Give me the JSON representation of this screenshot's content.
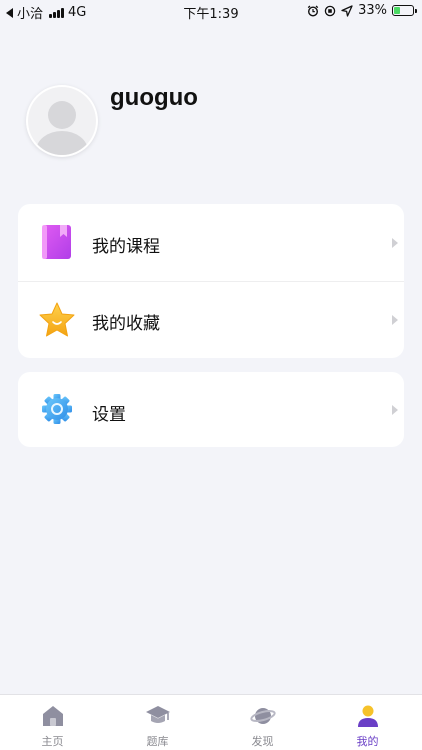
{
  "status_bar": {
    "carrier": "小洽",
    "network": "4G",
    "time": "下午1:39",
    "battery": "33%",
    "battery_level": 0.33,
    "icons": [
      "back-arrow-icon",
      "signal-icon",
      "alarm-icon",
      "orientation-lock-icon",
      "location-icon",
      "battery-icon"
    ]
  },
  "profile": {
    "username": "guoguo",
    "avatar_icon": "default-avatar-icon"
  },
  "menu": {
    "items": [
      {
        "label": "我的课程",
        "icon": "course-book-icon",
        "color": "#c94ef0"
      },
      {
        "label": "我的收藏",
        "icon": "star-icon",
        "color": "#f5b21c"
      }
    ],
    "settings": {
      "label": "设置",
      "icon": "gear-icon",
      "color": "#3ea7ef"
    }
  },
  "tabbar": {
    "tabs": [
      {
        "label": "主页",
        "icon": "home-icon",
        "active": false
      },
      {
        "label": "题库",
        "icon": "graduation-cap-icon",
        "active": false
      },
      {
        "label": "发现",
        "icon": "planet-icon",
        "active": false
      },
      {
        "label": "我的",
        "icon": "user-icon",
        "active": true
      }
    ],
    "active_color": "#6a3fc6",
    "inactive_color": "#8a8a90"
  }
}
